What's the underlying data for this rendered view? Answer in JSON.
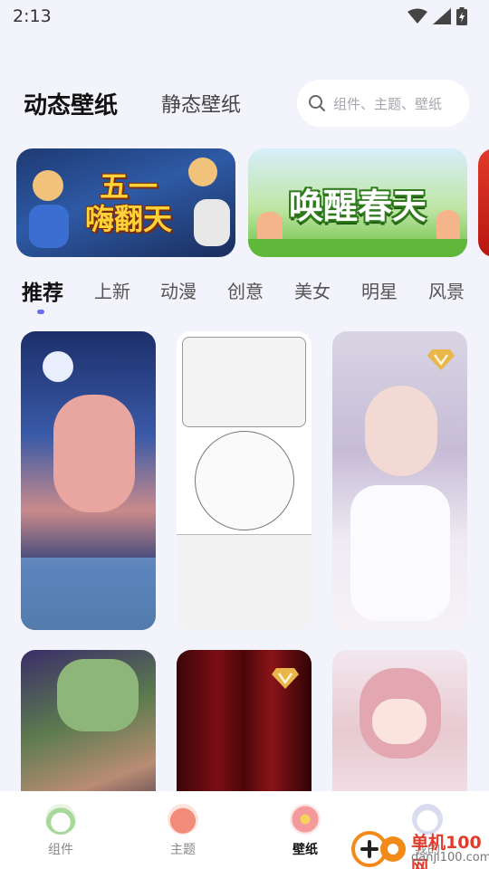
{
  "status_bar": {
    "time": "2:13",
    "icons": [
      "wifi-icon",
      "signal-icon",
      "battery-charging-icon"
    ]
  },
  "header": {
    "tabs": [
      {
        "label": "动态壁纸",
        "active": true
      },
      {
        "label": "静态壁纸",
        "active": false
      }
    ],
    "search": {
      "placeholder": "组件、主题、壁纸"
    }
  },
  "banners": [
    {
      "title": "五一\n嗨翻天"
    },
    {
      "title": "唤醒春天"
    },
    {
      "title": ""
    }
  ],
  "categories": [
    {
      "label": "推荐",
      "active": true
    },
    {
      "label": "上新"
    },
    {
      "label": "动漫"
    },
    {
      "label": "创意"
    },
    {
      "label": "美女"
    },
    {
      "label": "明星"
    },
    {
      "label": "风景"
    }
  ],
  "wallpapers": [
    {
      "subject": "anime fox-eared girl under moonlit cherry blossoms",
      "vip": false
    },
    {
      "subject": "black and white sketch of anime girls",
      "vip": false
    },
    {
      "subject": "silver-haired anime girl in white dress",
      "vip": true
    },
    {
      "subject": "green-haired swordsman close-up",
      "vip": false
    },
    {
      "subject": "dark red curtain stage",
      "vip": true
    },
    {
      "subject": "pink-haired bunny-eared anime girl",
      "vip": false
    }
  ],
  "bottom_nav": [
    {
      "label": "组件",
      "icon": "widget-icon",
      "active": false
    },
    {
      "label": "主题",
      "icon": "theme-icon",
      "active": false
    },
    {
      "label": "壁纸",
      "icon": "wallpaper-icon",
      "active": true
    },
    {
      "label": "我的",
      "icon": "profile-icon",
      "active": false
    }
  ],
  "watermark": {
    "text": "单机100网",
    "sub": "danji100.com"
  },
  "colors": {
    "accent": "#6b6cf0",
    "background": "#f3f3fb",
    "vip_gold": "#e9b64a"
  }
}
